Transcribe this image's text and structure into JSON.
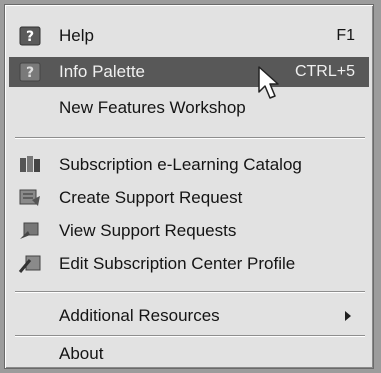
{
  "menu": {
    "items": [
      {
        "label": "Help",
        "shortcut": "F1",
        "icon": "help-icon"
      },
      {
        "label": "Info Palette",
        "shortcut": "CTRL+5",
        "icon": "help-icon",
        "highlighted": true
      },
      {
        "label": "New Features Workshop",
        "shortcut": ""
      },
      {
        "label": "Subscription e-Learning Catalog",
        "icon": "catalog-icon"
      },
      {
        "label": "Create Support Request",
        "icon": "support-request-icon"
      },
      {
        "label": "View Support Requests",
        "icon": "view-requests-icon"
      },
      {
        "label": "Edit Subscription Center Profile",
        "icon": "profile-icon"
      },
      {
        "label": "Additional Resources",
        "submenu": true
      },
      {
        "label": "About"
      }
    ]
  },
  "colors": {
    "menu_bg": "#e2e2e2",
    "highlight_bg": "#585858",
    "text": "#141414",
    "highlight_text": "#f0f0f0"
  }
}
